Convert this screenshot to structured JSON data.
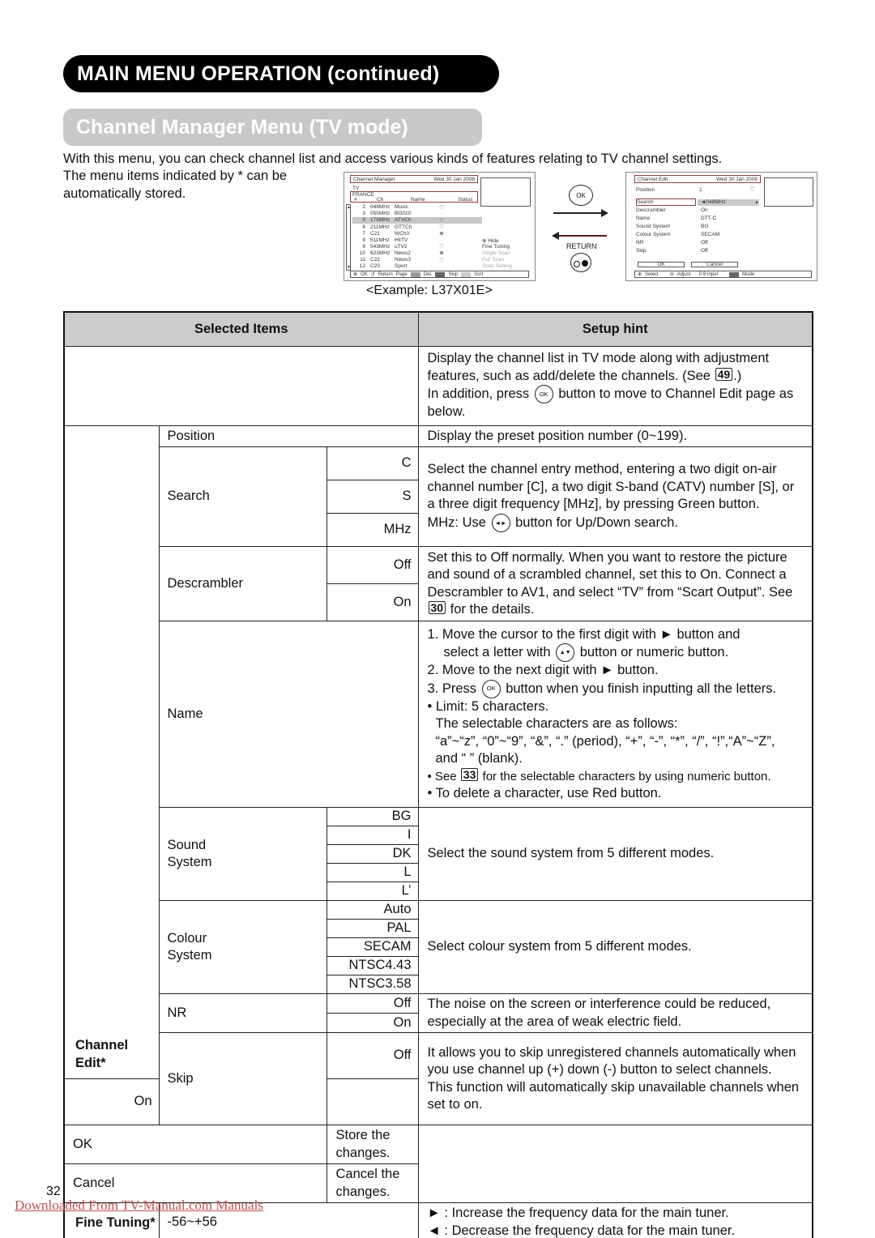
{
  "header": {
    "main_title": "MAIN MENU OPERATION (continued)",
    "section_title": "Channel Manager Menu (TV mode)"
  },
  "intro": {
    "line1": "With this menu, you can check channel list and access various kinds of features relating to TV channel settings.",
    "line2": "The menu items indicated by * can be automatically stored."
  },
  "screen_manager": {
    "title": "Channel Manager",
    "date": "Wed 30 Jan 2008",
    "source": "TV",
    "country": "FRANCE",
    "columns": [
      "#",
      "Ch",
      "Name",
      "Status"
    ],
    "rows": [
      {
        "num": "2",
        "ch": "048MHz",
        "name": "Music",
        "status": "♡"
      },
      {
        "num": "3",
        "ch": "055MHz",
        "name": "BG010",
        "status": ""
      },
      {
        "num": "5",
        "ch": "175MHz",
        "name": "ATVCh",
        "status": "♡"
      },
      {
        "num": "6",
        "ch": "211MHz",
        "name": "GTTCh",
        "status": "♡"
      },
      {
        "num": "7",
        "ch": "C21",
        "name": "WCh3",
        "status": "⊗"
      },
      {
        "num": "8",
        "ch": "511MHz",
        "name": "HitTV",
        "status": ""
      },
      {
        "num": "9",
        "ch": "543MHz",
        "name": "uTV2",
        "status": "♡"
      },
      {
        "num": "10",
        "ch": "623MHz",
        "name": "News2",
        "status": "⊗"
      },
      {
        "num": "11",
        "ch": "C22",
        "name": "News3",
        "status": "♡"
      },
      {
        "num": "12",
        "ch": "C23",
        "name": "Sport",
        "status": ""
      }
    ],
    "side_menu": [
      "⊗ Hide",
      "Fine Tuning",
      "Single Scan",
      "Full Scan",
      "Scan Setting"
    ],
    "footer": [
      "OK",
      "Return",
      "Page",
      "Del.",
      "Skip",
      "Sort"
    ],
    "footer_colors": {
      "del": "#999999",
      "skip": "#666666",
      "sort": "#cccccc"
    }
  },
  "screen_edit": {
    "title": "Channel Edit",
    "date": "Wed 30 Jan 2008",
    "position_label": "Position",
    "position_value": "1",
    "fields": [
      {
        "label": "Search",
        "value": "◄048MHz"
      },
      {
        "label": "Descrambler",
        "value": "On"
      },
      {
        "label": "Name",
        "value": "DTT-C"
      },
      {
        "label": "Sound System",
        "value": "BG"
      },
      {
        "label": "Colour System",
        "value": "SECAM"
      },
      {
        "label": "NR",
        "value": "Off"
      },
      {
        "label": "Skip",
        "value": "Off"
      }
    ],
    "ok_button": "OK",
    "cancel_button": "Cancel",
    "footer": [
      "Select",
      "Adjust",
      "0-9 Input",
      "Mode"
    ]
  },
  "nav": {
    "ok_label": "OK",
    "return_label": "RETURN",
    "example_caption": "<Example: L37X01E>"
  },
  "table": {
    "headers": [
      "Selected Items",
      "Setup hint"
    ],
    "overview_hint": {
      "p1": "Display the channel list in TV mode along with adjustment features, such as add/delete the channels. (See ",
      "ref": "49",
      "p1_end": ".)",
      "p2_a": "In addition, press ",
      "p2_icon": "OK",
      "p2_b": " button to move to Channel Edit page as below."
    },
    "group_channel_edit": "Channel Edit*",
    "position": {
      "label": "Position",
      "hint": "Display the preset position number (0~199)."
    },
    "search": {
      "label": "Search",
      "options": [
        "C",
        "S",
        "MHz"
      ],
      "hint1": "Select the channel entry method, entering a two digit on-air channel number [C], a two digit S-band (CATV) number [S], or a three digit frequency [MHz], by pressing Green button.",
      "hint2_a": "MHz: Use ",
      "hint2_icon": "◄►",
      "hint2_b": " button for Up/Down search."
    },
    "descrambler": {
      "label": "Descrambler",
      "options": [
        "Off",
        "On"
      ],
      "hint_a": "Set this to Off normally. When you want to restore the picture and sound of a scrambled channel, set this to On. Connect a Descrambler to AV1, and select “TV” from “Scart Output”. See ",
      "ref": "30",
      "hint_b": " for the details."
    },
    "name": {
      "label": "Name",
      "step1_a": "1. Move the cursor to the first digit with ► button and",
      "step1_b": "select a letter with ",
      "step1_icon": "▲▼",
      "step1_c": " button or numeric button.",
      "step2": "2. Move to the next digit with ► button.",
      "step3_a": "3. Press ",
      "step3_icon": "OK",
      "step3_b": " button when you finish inputting all the letters.",
      "limit": "• Limit: 5 characters.",
      "chars_intro": "The selectable characters are as follows:",
      "chars_list": "“a”~“z”, “0”~“9”, “&”, “.” (period), “+”, “-”, “*”, “/”, “!”,“A”~“Z”,",
      "chars_blank": "and “ ” (blank).",
      "see_a": "• See ",
      "see_ref": "33",
      "see_b": " for the selectable characters by using numeric button.",
      "delete": "• To delete a character, use Red button."
    },
    "sound_system": {
      "label": "Sound System",
      "options": [
        "BG",
        "I",
        "DK",
        "L",
        "L’"
      ],
      "hint": "Select the sound system from 5 different modes."
    },
    "colour_system": {
      "label": "Colour System",
      "options": [
        "Auto",
        "PAL",
        "SECAM",
        "NTSC4.43",
        "NTSC3.58"
      ],
      "hint": "Select colour system from 5 different modes."
    },
    "nr": {
      "label": "NR",
      "options": [
        "Off",
        "On"
      ],
      "hint": "The noise on the screen or interference could be reduced, especially at the area of weak electric field."
    },
    "skip": {
      "label": "Skip",
      "options": [
        "Off",
        "On"
      ],
      "hint1": "It allows you to skip unregistered channels automatically when you use channel up (+) down (-) button to select channels.",
      "hint2": "This function will automatically skip unavailable channels when set to on."
    },
    "ok": {
      "label": "OK",
      "hint": "Store the changes."
    },
    "cancel": {
      "label": "Cancel",
      "hint": "Cancel the changes."
    },
    "fine_tuning": {
      "label": "Fine Tuning*",
      "range": "-56~+56",
      "hint1": "► : Increase the frequency data for the main tuner.",
      "hint2": "◄ : Decrease the frequency data for the main tuner."
    }
  },
  "footer": {
    "page_number": "32",
    "download_link": "Downloaded From TV-Manual.com Manuals"
  },
  "colors": {
    "banner_main": "#000000",
    "banner_sub": "#c8c8c8",
    "table_header": "#cccccc",
    "link": "#c0504d"
  }
}
